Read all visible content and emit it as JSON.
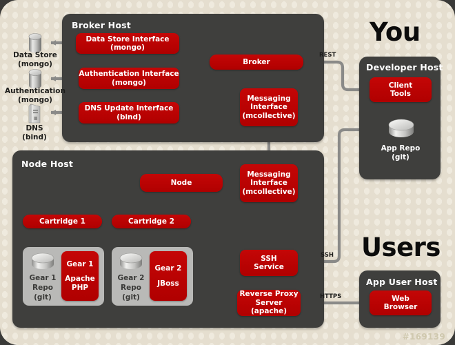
{
  "meta": {
    "watermark": "#169139"
  },
  "headings": {
    "you": "You",
    "users": "Users"
  },
  "panels": {
    "broker_host": "Broker Host",
    "node_host": "Node Host",
    "developer_host": "Developer Host",
    "app_user_host": "App User Host"
  },
  "broker": {
    "data_store_interface": "Data Store Interface\n(mongo)",
    "data_store_interface_l1": "Data Store Interface",
    "data_store_interface_l2": "(mongo)",
    "auth_interface_l1": "Authentication Interface",
    "auth_interface_l2": "(mongo)",
    "dns_interface_l1": "DNS Update Interface",
    "dns_interface_l2": "(bind)",
    "broker_label": "Broker",
    "messaging_l1": "Messaging",
    "messaging_l2": "Interface",
    "messaging_l3": "(mcollective)"
  },
  "external_icons": {
    "data_store_l1": "Data Store",
    "data_store_l2": "(mongo)",
    "auth_l1": "Authentication",
    "auth_l2": "(mongo)",
    "dns_l1": "DNS",
    "dns_l2": "(bind)"
  },
  "node": {
    "node_label": "Node",
    "messaging_l1": "Messaging",
    "messaging_l2": "Interface",
    "messaging_l3": "(mcollective)",
    "cartridge1": "Cartridge 1",
    "cartridge2": "Cartridge 2",
    "ssh_l1": "SSH",
    "ssh_l2": "Service",
    "proxy_l1": "Reverse Proxy",
    "proxy_l2": "Server (apache)",
    "gear1": {
      "repo_l1": "Gear 1",
      "repo_l2": "Repo",
      "repo_l3": "(git)",
      "app_l1": "Gear 1",
      "app_l2": "Apache",
      "app_l3": "PHP"
    },
    "gear2": {
      "repo_l1": "Gear 2",
      "repo_l2": "Repo",
      "repo_l3": "(git)",
      "app_l1": "Gear 2",
      "app_l2": "JBoss",
      "app_l3": ""
    }
  },
  "developer": {
    "client_tools_l1": "Client",
    "client_tools_l2": "Tools",
    "app_repo_l1": "App Repo",
    "app_repo_l2": "(git)"
  },
  "appuser": {
    "web_browser_l1": "Web",
    "web_browser_l2": "Browser"
  },
  "edge_labels": {
    "rest": "REST",
    "ssh": "SSH",
    "https": "HTTPS"
  },
  "colors": {
    "background": "#e5decf",
    "dot": "#efeade",
    "panel": "#3f3f3d",
    "red": "#c00000",
    "gray_box": "#b9b9b7",
    "connector": "#8a8a88",
    "frame": "#3a3a38"
  }
}
